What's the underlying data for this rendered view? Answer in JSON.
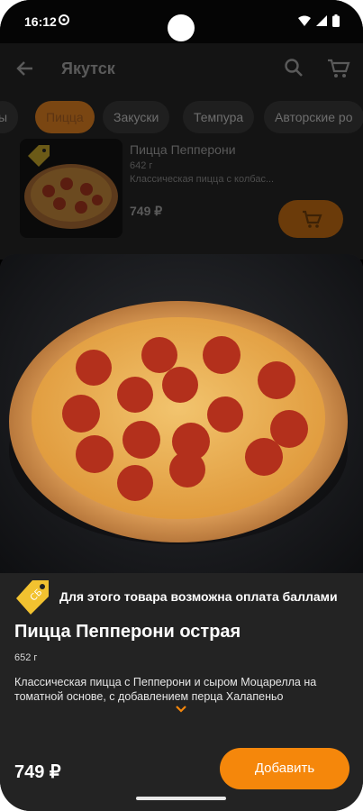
{
  "status_bar": {
    "time": "16:12",
    "icons": [
      "settings-icon",
      "wifi-icon",
      "signal-icon",
      "battery-icon"
    ]
  },
  "app_bar": {
    "city": "Якутск",
    "icons": [
      "back-arrow-icon",
      "search-icon",
      "cart-icon"
    ]
  },
  "categories": [
    {
      "label": "ы",
      "active": false
    },
    {
      "label": "Пицца",
      "active": true
    },
    {
      "label": "Закуски",
      "active": false
    },
    {
      "label": "Темпура",
      "active": false
    },
    {
      "label": "Авторские ро",
      "active": false
    }
  ],
  "list_item": {
    "title": "Пицца Пепперони",
    "weight": "642 г",
    "description": "Классическая пицца с колбас...",
    "price": "749 ₽"
  },
  "sheet": {
    "points_text": "Для этого товара возможна оплата баллами",
    "title": "Пицца Пепперони острая",
    "weight": "652 г",
    "description": "Классическая пицца с Пепперони и сыром Моцарелла на томатной основе, с добавлением перца Халапеньо",
    "price": "749 ₽",
    "add_label": "Добавить"
  },
  "colors": {
    "accent": "#f5870b",
    "sheet_bg": "#232323",
    "background": "#000000"
  }
}
